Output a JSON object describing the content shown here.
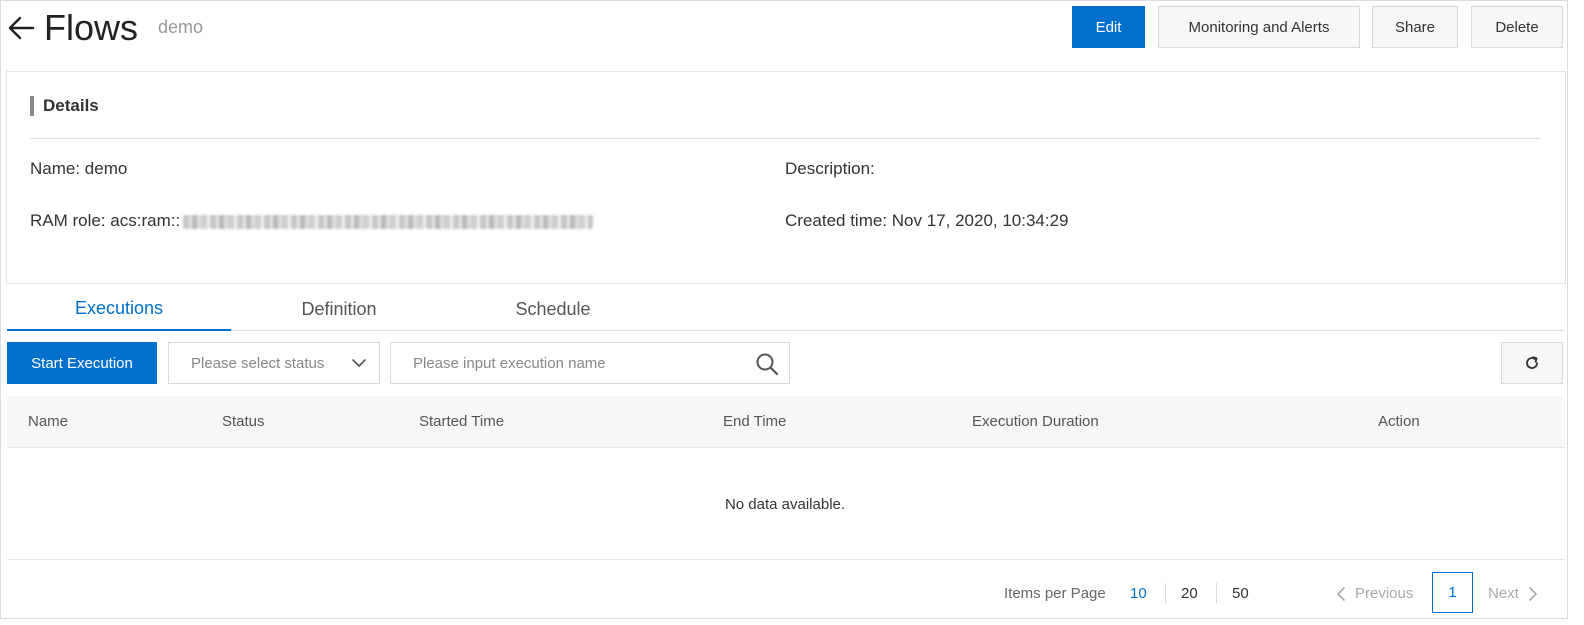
{
  "header": {
    "title": "Flows",
    "subtitle": "demo",
    "buttons": {
      "edit": "Edit",
      "monitoring": "Monitoring and Alerts",
      "share": "Share",
      "delete": "Delete"
    }
  },
  "details": {
    "heading": "Details",
    "name_label": "Name: demo",
    "ram_label": "RAM role: acs:ram::",
    "description_label": "Description:",
    "created_label": "Created time: Nov 17, 2020, 10:34:29"
  },
  "tabs": [
    {
      "label": "Executions",
      "active": true
    },
    {
      "label": "Definition",
      "active": false
    },
    {
      "label": "Schedule",
      "active": false
    }
  ],
  "toolbar": {
    "start_label": "Start Execution",
    "status_placeholder": "Please select status",
    "search_placeholder": "Please input execution name"
  },
  "table": {
    "columns": [
      "Name",
      "Status",
      "Started Time",
      "End Time",
      "Execution Duration",
      "Action"
    ],
    "empty_text": "No data available."
  },
  "pagination": {
    "items_per_page_label": "Items per Page",
    "sizes": [
      "10",
      "20",
      "50"
    ],
    "selected_size": "10",
    "previous_label": "Previous",
    "next_label": "Next",
    "current_page": "1"
  },
  "colors": {
    "accent": "#0070cc",
    "border": "#d9d9d9"
  }
}
